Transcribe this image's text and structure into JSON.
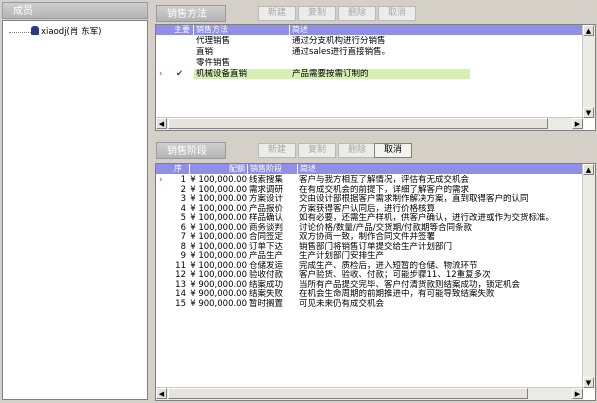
{
  "left": {
    "title": "成员",
    "user": "xiaodj(肖 东军)"
  },
  "top": {
    "title": "销售方法",
    "buttons": [
      "新建",
      "复制",
      "删除",
      "取消"
    ],
    "headers": [
      "主要",
      "销售方法",
      "简述"
    ],
    "rows": [
      {
        "marker": "",
        "main": "",
        "name": "代理销售",
        "desc": "通过分支机构进行分销售"
      },
      {
        "marker": "",
        "main": "",
        "name": "直销",
        "desc": "通过sales进行直接销售。"
      },
      {
        "marker": "",
        "main": "",
        "name": "零件销售",
        "desc": ""
      },
      {
        "marker": "›",
        "main": "✔",
        "name": "机械设备直销",
        "desc": "产品需要按需订制的"
      }
    ]
  },
  "bottom": {
    "title": "销售阶段",
    "buttons": [
      "新建",
      "复制",
      "删除",
      "取消"
    ],
    "headers": [
      "序",
      "配额",
      "销售阶段",
      "简述"
    ],
    "rows": [
      {
        "marker": "›",
        "seq": "1",
        "quota": "¥ 100,000.00",
        "stage": "线索搜集",
        "desc": "客户与我方相互了解情况，评估有无成交机会"
      },
      {
        "marker": "",
        "seq": "2",
        "quota": "¥ 100,000.00",
        "stage": "需求调研",
        "desc": "在有成交机会的前提下，详细了解客户的需求"
      },
      {
        "marker": "",
        "seq": "3",
        "quota": "¥ 100,000.00",
        "stage": "方案设计",
        "desc": "交由设计部根据客户需求制作解决方案，直到取得客户的认同"
      },
      {
        "marker": "",
        "seq": "4",
        "quota": "¥ 100,000.00",
        "stage": "产品报价",
        "desc": "方案获得客户认同后，进行价格核算"
      },
      {
        "marker": "",
        "seq": "5",
        "quota": "¥ 100,000.00",
        "stage": "样品确认",
        "desc": "如有必要，还需生产样机，供客户确认，进行改进或作为交货标准。"
      },
      {
        "marker": "",
        "seq": "6",
        "quota": "¥ 100,000.00",
        "stage": "商务谈判",
        "desc": "讨论价格/数量/产品/交货期/付款期等合同条款"
      },
      {
        "marker": "",
        "seq": "7",
        "quota": "¥ 100,000.00",
        "stage": "合同签定",
        "desc": "双方协商一致，制作合同文件并签署"
      },
      {
        "marker": "",
        "seq": "8",
        "quota": "¥ 100,000.00",
        "stage": "订单下达",
        "desc": "销售部门将销售订单提交给生产计划部门"
      },
      {
        "marker": "",
        "seq": "9",
        "quota": "¥ 100,000.00",
        "stage": "产品生产",
        "desc": "生产计划部门安排生产"
      },
      {
        "marker": "",
        "seq": "11",
        "quota": "¥ 100,000.00",
        "stage": "仓储发运",
        "desc": "完成生产、质检后，进入短暂的仓储、物流环节"
      },
      {
        "marker": "",
        "seq": "12",
        "quota": "¥ 100,000.00",
        "stage": "验收付款",
        "desc": "客户验货、验收、付款；可能步骤11、12重复多次"
      },
      {
        "marker": "",
        "seq": "13",
        "quota": "¥ 900,000.00",
        "stage": "结案成功",
        "desc": "当所有产品提交完毕、客户付清货款则结案成功，锁定机会"
      },
      {
        "marker": "",
        "seq": "14",
        "quota": "¥ 900,000.00",
        "stage": "结案失败",
        "desc": "在机会生命周期的前期推进中，有可能导致结案失败"
      },
      {
        "marker": "",
        "seq": "15",
        "quota": "¥ 900,000.00",
        "stage": "暂时搁置",
        "desc": "可见未来仍有成交机会"
      }
    ]
  },
  "colors": {
    "header": "#8f8ee8",
    "selected_row": "#d6f0b4",
    "caption": "#b4b4b4"
  },
  "icons": {
    "user": "person-icon",
    "check": "checkmark-icon",
    "row_marker": "row-pointer-icon"
  }
}
